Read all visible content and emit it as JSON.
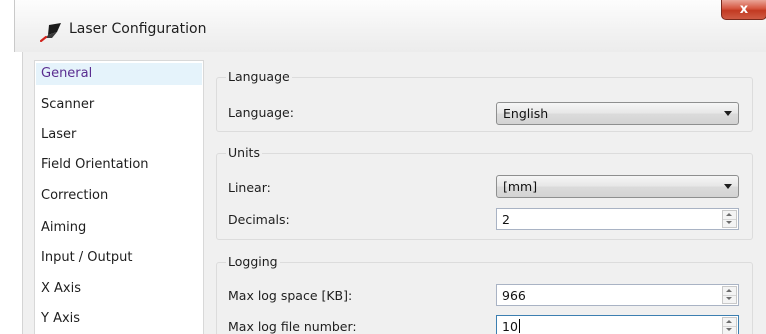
{
  "window": {
    "title": "Laser Configuration",
    "close_label": "x"
  },
  "nav": {
    "items": [
      {
        "label": "General",
        "selected": true
      },
      {
        "label": "Scanner"
      },
      {
        "label": "Laser"
      },
      {
        "label": "Field Orientation"
      },
      {
        "label": "Correction"
      },
      {
        "label": "Aiming"
      },
      {
        "label": "Input / Output"
      },
      {
        "label": "X Axis"
      },
      {
        "label": "Y Axis"
      }
    ]
  },
  "language_group": {
    "title": "Language",
    "language_label": "Language:",
    "language_value": "English"
  },
  "units_group": {
    "title": "Units",
    "linear_label": "Linear:",
    "linear_value": "[mm]",
    "decimals_label": "Decimals:",
    "decimals_value": "2"
  },
  "logging_group": {
    "title": "Logging",
    "max_log_space_label": "Max log space [KB]:",
    "max_log_space_value": "966",
    "max_log_file_label": "Max log file number:",
    "max_log_file_value": "10"
  },
  "colors": {
    "selected_nav_text": "#5a2d90",
    "selected_nav_bg": "#e5f3fb",
    "close_button": "#c9442c",
    "dialog_bg": "#f0f0f0"
  }
}
